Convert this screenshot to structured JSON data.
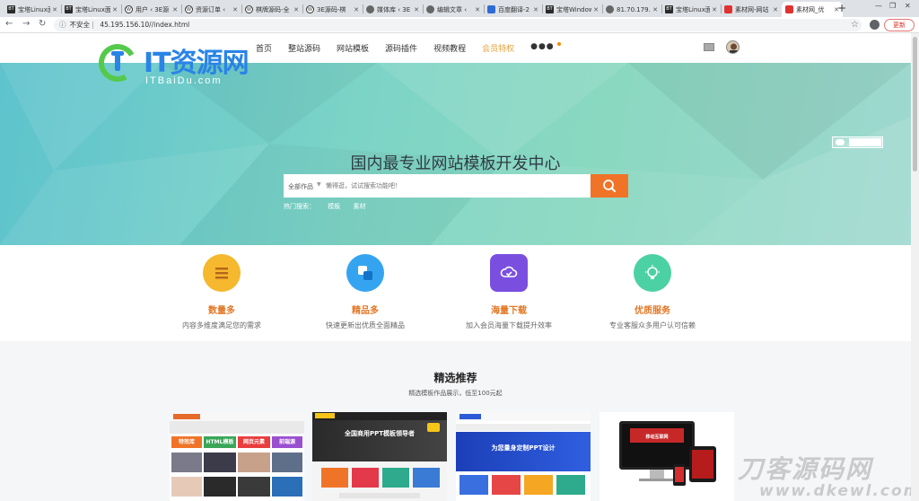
{
  "browser": {
    "tabs": [
      {
        "label": "宝塔Linux面板",
        "favicon": "BT"
      },
      {
        "label": "宝塔Linux面板",
        "favicon": "BT"
      },
      {
        "label": "用户 ‹ 3E源",
        "favicon": "wp"
      },
      {
        "label": "资源订单 ‹",
        "favicon": "wp"
      },
      {
        "label": "棋牌源码-全",
        "favicon": "wp"
      },
      {
        "label": "3E源码-棋",
        "favicon": "wp"
      },
      {
        "label": "媒体库 ‹ 3E",
        "favicon": "globe"
      },
      {
        "label": "编辑文章 ‹",
        "favicon": "globe"
      },
      {
        "label": "百度翻译-2",
        "favicon": "baidu"
      },
      {
        "label": "宝塔Windows",
        "favicon": "BT"
      },
      {
        "label": "81.70.179.",
        "favicon": "globe"
      },
      {
        "label": "宝塔Linux面",
        "favicon": "BT"
      },
      {
        "label": "素材网-网站",
        "favicon": "red"
      },
      {
        "label": "素材网_优",
        "favicon": "red",
        "active": true
      }
    ],
    "new_tab": "+",
    "url_warning": "不安全",
    "url": "45.195.156.10//index.html",
    "update_button": "更新"
  },
  "site": {
    "logo_text": "IT资源网",
    "logo_sub": "ITBaiDu.com",
    "nav": {
      "item1": "首页",
      "item2": "整站源码",
      "item3": "网站模板",
      "item4": "源码插件",
      "item5": "视频教程",
      "vip": "会员特权",
      "more": "●●●"
    },
    "hero": {
      "title": "国内最专业网站模板开发中心",
      "search_category": "全部作品",
      "search_placeholder": "懒得逛，试试搜索功能吧！",
      "hot_label": "热门搜索：",
      "hot_1": "模板",
      "hot_2": "素材"
    },
    "features": [
      {
        "title": "数量多",
        "desc": "内容多维度满足您的需求",
        "color": "#f5b82e",
        "icon": "list-icon"
      },
      {
        "title": "精品多",
        "desc": "快速更新出优质全面精品",
        "color": "#35a4f0",
        "icon": "squares-icon"
      },
      {
        "title": "海量下载",
        "desc": "加入会员海量下载提升效率",
        "color": "#7a4fe0",
        "icon": "cloud-check-icon"
      },
      {
        "title": "优质服务",
        "desc": "专业客服众多用户认可信赖",
        "color": "#4bd1a4",
        "icon": "bulb-icon"
      }
    ],
    "picks": {
      "title": "精选推荐",
      "subtitle": "精选模板作品展示，低至100元起",
      "card1_tags": [
        "特效库",
        "HTML模板",
        "网页元素",
        "前端源"
      ],
      "card2_banner": "全国商用PPT模板领导者",
      "card3_banner": "为您量身定制PPT设计",
      "card4_title": "移动互联网"
    },
    "watermark": "刀客源码网",
    "watermark_sub": "www.dkewl.com"
  }
}
